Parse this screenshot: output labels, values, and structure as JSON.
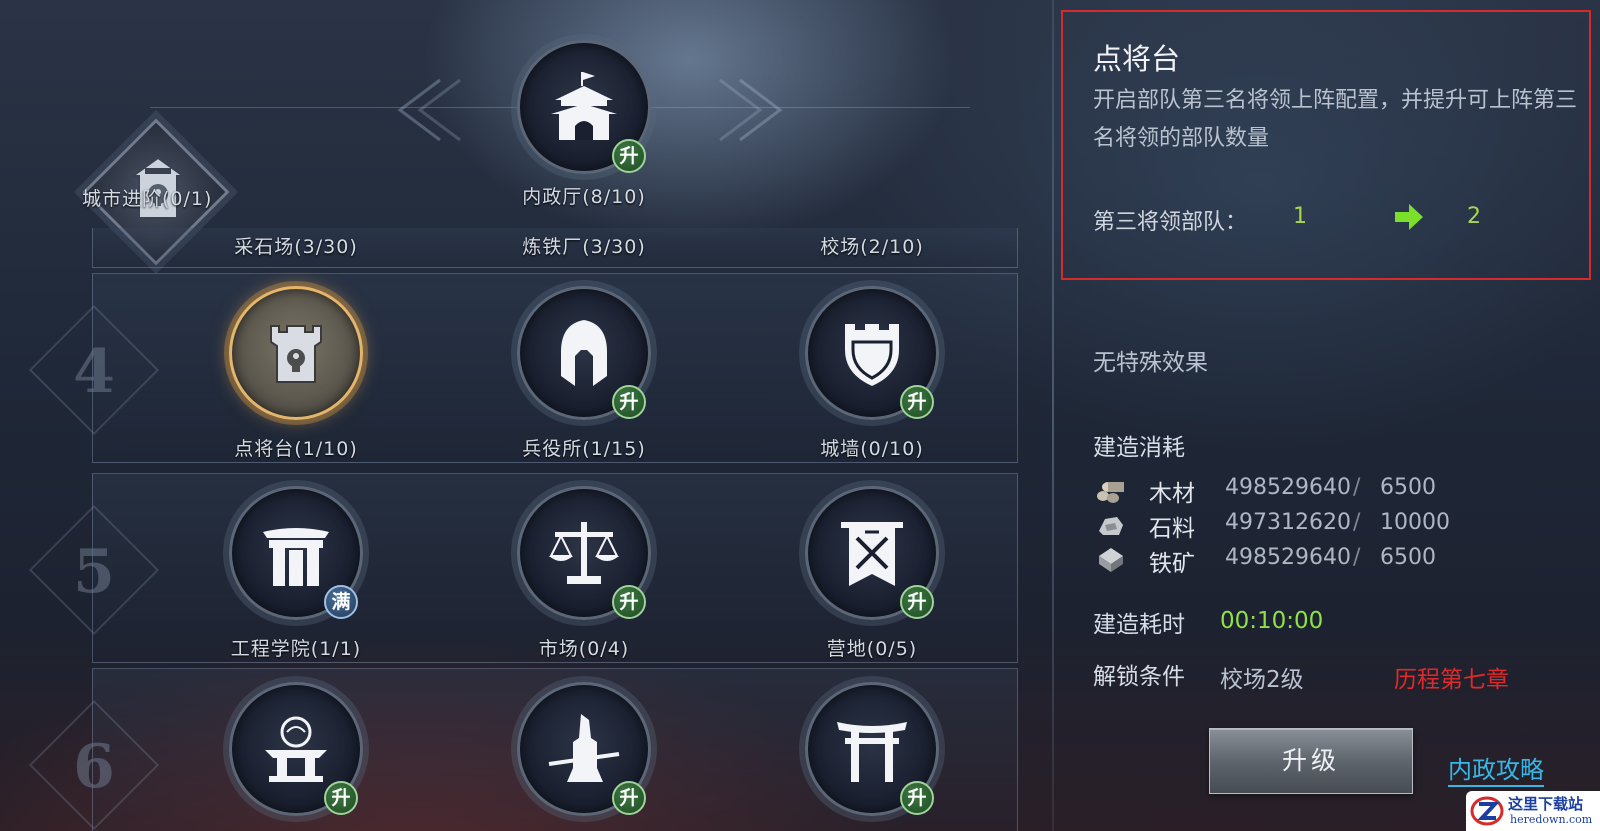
{
  "top_row": {
    "city_advance": {
      "label": "城市进阶(0/1)",
      "icon": "locked-fortress-icon"
    },
    "council_hall": {
      "label": "内政厅(8/10)",
      "badge": "升",
      "icon": "palace-gate-icon"
    }
  },
  "tier3_labels": [
    "采石场(3/30)",
    "炼铁厂(3/30)",
    "校场(2/10)"
  ],
  "tiers": [
    {
      "number": "4",
      "buildings": [
        {
          "label": "点将台(1/10)",
          "icon": "locked-tower-icon",
          "badge": "",
          "selected": true
        },
        {
          "label": "兵役所(1/15)",
          "icon": "spartan-helmet-icon",
          "badge": "升"
        },
        {
          "label": "城墙(0/10)",
          "icon": "castle-shield-icon",
          "badge": "升"
        }
      ]
    },
    {
      "number": "5",
      "buildings": [
        {
          "label": "工程学院(1/1)",
          "icon": "academy-gate-icon",
          "badge": "满"
        },
        {
          "label": "市场(0/4)",
          "icon": "balance-scale-icon",
          "badge": "升"
        },
        {
          "label": "营地(0/5)",
          "icon": "crossed-swords-banner-icon",
          "badge": "升"
        }
      ]
    },
    {
      "number": "6",
      "buildings": [
        {
          "label": "",
          "icon": "altar-orb-icon",
          "badge": "升"
        },
        {
          "label": "",
          "icon": "warrior-statue-icon",
          "badge": "升"
        },
        {
          "label": "",
          "icon": "torii-gate-icon",
          "badge": "升"
        }
      ]
    }
  ],
  "detail": {
    "title": "点将台",
    "description": "开启部队第三名将领上阵配置，并提升可上阵第三名将领的部队数量",
    "stat_label": "第三将领部队：",
    "stat_from": "1",
    "stat_to": "2",
    "special_effect": "无特殊效果",
    "cost_title": "建造消耗",
    "resources": [
      {
        "icon": "wood-icon",
        "name": "木材",
        "have": "498529640",
        "need": "6500"
      },
      {
        "icon": "stone-icon",
        "name": "石料",
        "have": "497312620",
        "need": "10000"
      },
      {
        "icon": "iron-ore-icon",
        "name": "铁矿",
        "have": "498529640",
        "need": "6500"
      }
    ],
    "time_label": "建造耗时",
    "time_value": "00:10:00",
    "unlock_label": "解锁条件",
    "unlock_req1": "校场2级",
    "unlock_req2": "历程第七章",
    "upgrade_button": "升级",
    "guide_link": "内政攻略"
  },
  "watermark": {
    "line1": "这里下载站",
    "line2": "heredown.com"
  },
  "colors": {
    "highlight_border": "#d72a2a",
    "green_value": "#a8d84a",
    "time_green": "#8fe04a",
    "unlock_red": "#e02a2a",
    "link_blue": "#35b8e8"
  }
}
